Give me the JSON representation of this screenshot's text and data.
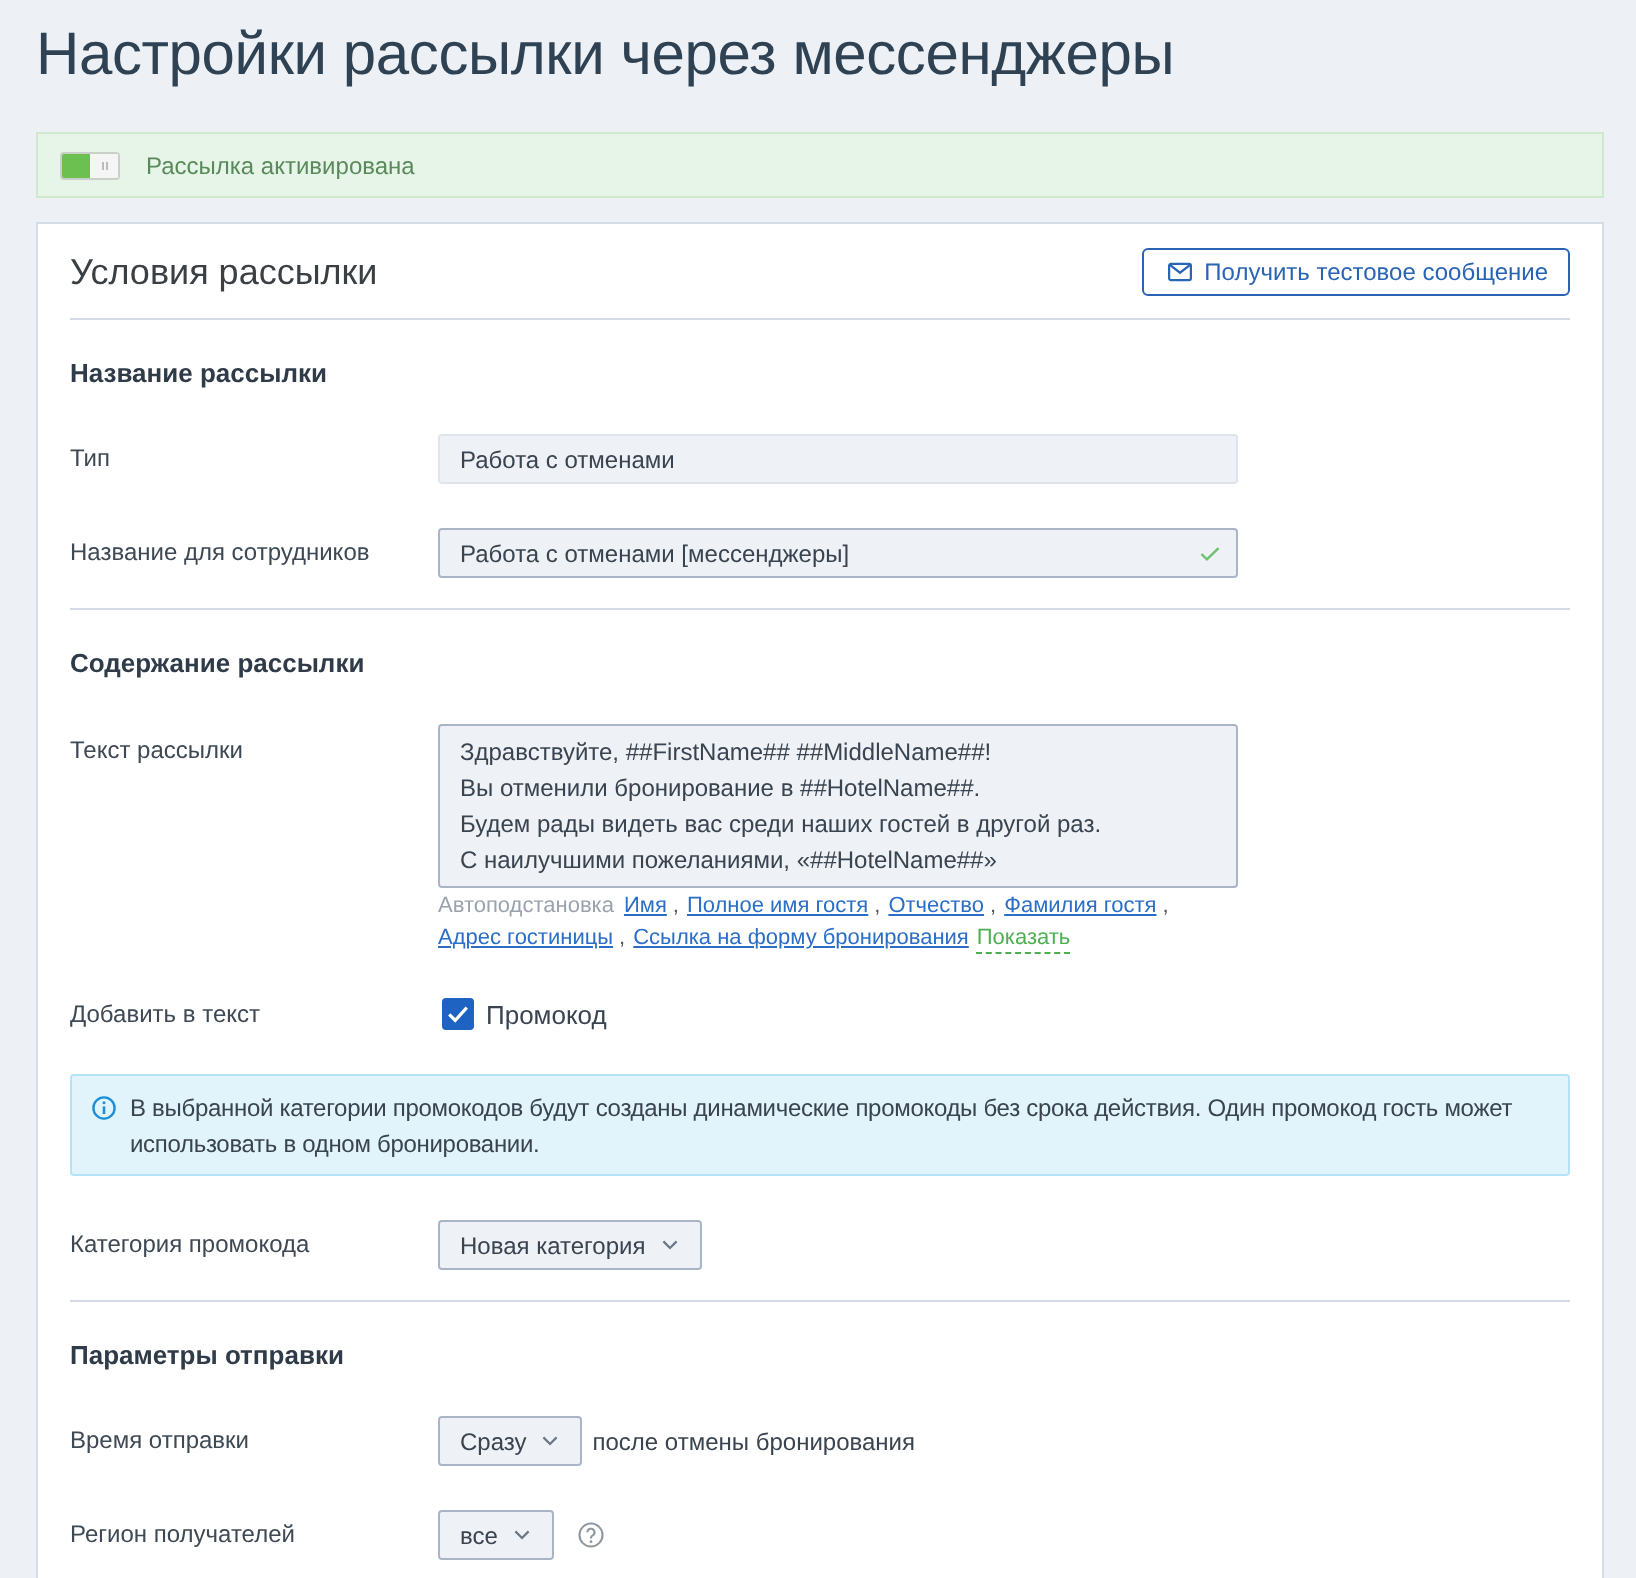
{
  "page_title": "Настройки рассылки через мессенджеры",
  "status_banner": {
    "on": true,
    "text": "Рассылка активирована"
  },
  "card": {
    "title": "Условия рассылки",
    "test_button": "Получить тестовое сообщение"
  },
  "sections": [
    {
      "heading": "Название рассылки",
      "rows": [
        {
          "kind": "input",
          "label": "Тип",
          "value": "Работа с отменами",
          "disabled": true,
          "valid": false
        },
        {
          "kind": "input",
          "label": "Название для сотрудников",
          "value": "Работа с отменами [мессенджеры]",
          "disabled": false,
          "valid": true
        }
      ]
    },
    {
      "heading": "Содержание рассылки",
      "rows": [
        {
          "kind": "textarea",
          "label": "Текст рассылки",
          "value": "Здравствуйте, ##FirstName## ##MiddleName##!\nВы отменили бронирование в ##HotelName##.\nБудем рады видеть вас среди наших гостей в другой раз.\nС наилучшими пожеланиями, «##HotelName##»",
          "autofill": {
            "label": "Автоподстановка",
            "separator": ",",
            "links": [
              "Имя",
              "Полное имя гостя",
              "Отчество",
              "Фамилия гостя",
              "Адрес гостиницы",
              "Ссылка на форму бронирования"
            ],
            "toggle": "Показать"
          }
        },
        {
          "kind": "checkbox",
          "label": "Добавить в текст",
          "option": "Промокод",
          "checked": true
        },
        {
          "kind": "alert",
          "text": "В выбранной категории промокодов будут созданы динамические промокоды без срока действия. Один промокод гость может использовать в одном бронировании."
        },
        {
          "kind": "select",
          "label": "Категория промокода",
          "value": "Новая категория"
        }
      ]
    },
    {
      "heading": "Параметры отправки",
      "rows": [
        {
          "kind": "select",
          "label": "Время отправки",
          "value": "Сразу",
          "suffix": "после отмены бронирования"
        },
        {
          "kind": "select",
          "label": "Регион получателей",
          "value": "все",
          "help": true
        }
      ]
    }
  ]
}
